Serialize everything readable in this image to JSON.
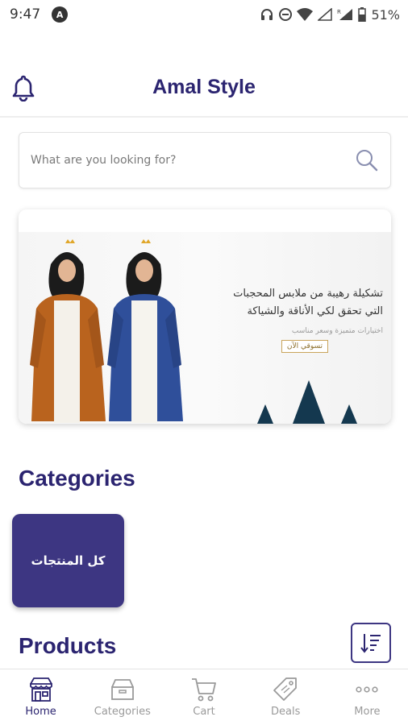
{
  "status_bar": {
    "time": "9:47",
    "notification_glyph": "A",
    "battery": "51%"
  },
  "header": {
    "title": "Amal Style"
  },
  "search": {
    "placeholder": "What are you looking for?"
  },
  "banner": {
    "headline_line1": "تشكيلة رهيبة من ملابس المحجبات",
    "headline_line2": "التي تحقق لكي الأناقة والشياكة",
    "subline": "اختيارات متميزة وسعر مناسب",
    "button": "تسوقي الآن"
  },
  "categories": {
    "title": "Categories",
    "items": [
      {
        "label": "كل المنتجات"
      }
    ]
  },
  "products": {
    "title": "Products"
  },
  "bottom_nav": {
    "items": [
      {
        "label": "Home",
        "icon": "store-icon",
        "active": true
      },
      {
        "label": "Categories",
        "icon": "box-icon",
        "active": false
      },
      {
        "label": "Cart",
        "icon": "cart-icon",
        "active": false
      },
      {
        "label": "Deals",
        "icon": "tag-icon",
        "active": false
      },
      {
        "label": "More",
        "icon": "more-icon",
        "active": false
      }
    ]
  },
  "colors": {
    "primary": "#2b2470",
    "card": "#3d3682",
    "inactive": "#9a9a9a"
  }
}
